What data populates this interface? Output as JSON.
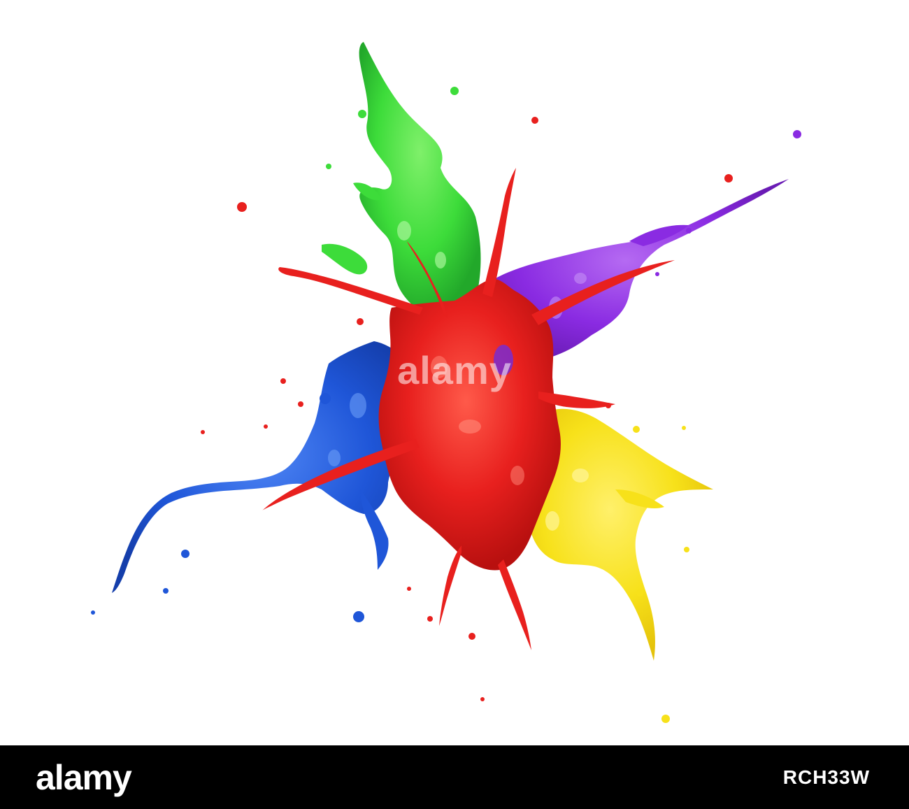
{
  "photo": {
    "background": "#ffffff",
    "splashes": [
      {
        "name": "green-splash",
        "color": "#3ddc3a"
      },
      {
        "name": "purple-splash",
        "color": "#8a2be2"
      },
      {
        "name": "blue-splash",
        "color": "#1f56d8"
      },
      {
        "name": "yellow-splash",
        "color": "#f7e11a"
      },
      {
        "name": "red-splash",
        "color": "#e8201e"
      }
    ]
  },
  "watermark": {
    "text": "alamy"
  },
  "footer": {
    "background": "#000000",
    "brand": "alamy",
    "image_id": "RCH33W"
  }
}
